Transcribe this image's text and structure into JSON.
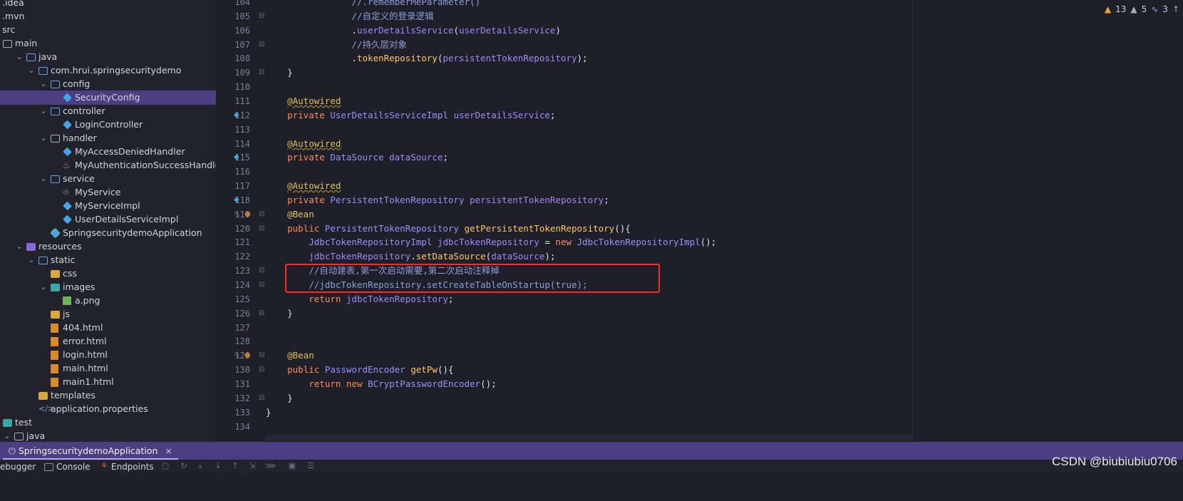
{
  "tree": {
    "items": [
      {
        "label": ".idea",
        "icon": "folder-icon",
        "chev": ""
      },
      {
        "label": ".mvn",
        "icon": "folder-icon",
        "chev": ""
      },
      {
        "label": "src",
        "icon": "folder-icon",
        "chev": ""
      },
      {
        "label": "main",
        "icon": "folder-icon",
        "chev": ""
      },
      {
        "label": "java",
        "icon": "source-folder-icon",
        "chev": "v"
      },
      {
        "label": "com.hrui.springsecuritydemo",
        "icon": "package-icon",
        "chev": "v"
      },
      {
        "label": "config",
        "icon": "package-icon",
        "chev": "v"
      },
      {
        "label": "SecurityConfig",
        "icon": "class-icon",
        "chev": "",
        "selected": true
      },
      {
        "label": "controller",
        "icon": "package-icon",
        "chev": "v"
      },
      {
        "label": "LoginController",
        "icon": "class-icon",
        "chev": ""
      },
      {
        "label": "handler",
        "icon": "folder-icon",
        "chev": "v"
      },
      {
        "label": "MyAccessDeniedHandler",
        "icon": "class-icon",
        "chev": ""
      },
      {
        "label": "MyAuthenticationSuccessHandler.jav",
        "icon": "java-file-icon",
        "chev": ""
      },
      {
        "label": "service",
        "icon": "package-icon",
        "chev": "v"
      },
      {
        "label": "MyService",
        "icon": "interface-icon",
        "chev": ""
      },
      {
        "label": "MyServiceImpl",
        "icon": "class-icon",
        "chev": ""
      },
      {
        "label": "UserDetailsServiceImpl",
        "icon": "class-icon",
        "chev": ""
      },
      {
        "label": "SpringsecuritydemoApplication",
        "icon": "spring-app-icon",
        "chev": ""
      },
      {
        "label": "resources",
        "icon": "resources-folder-icon",
        "chev": "v"
      },
      {
        "label": "static",
        "icon": "package-icon",
        "chev": "v"
      },
      {
        "label": "css",
        "icon": "folder-icon",
        "chev": ""
      },
      {
        "label": "images",
        "icon": "folder-icon",
        "chev": "v"
      },
      {
        "label": "a.png",
        "icon": "image-file-icon",
        "chev": ""
      },
      {
        "label": "js",
        "icon": "folder-icon",
        "chev": ""
      },
      {
        "label": "404.html",
        "icon": "html-file-icon",
        "chev": ""
      },
      {
        "label": "error.html",
        "icon": "html-file-icon",
        "chev": ""
      },
      {
        "label": "login.html",
        "icon": "html-file-icon",
        "chev": ""
      },
      {
        "label": "main.html",
        "icon": "html-file-icon",
        "chev": ""
      },
      {
        "label": "main1.html",
        "icon": "html-file-icon",
        "chev": ""
      },
      {
        "label": "templates",
        "icon": "folder-icon",
        "chev": ""
      },
      {
        "label": "application.properties",
        "icon": "properties-file-icon",
        "chev": ""
      },
      {
        "label": "test",
        "icon": "folder-icon",
        "chev": ""
      },
      {
        "label": "java",
        "icon": "folder-icon",
        "chev": "v"
      }
    ]
  },
  "editor": {
    "lines": [
      {
        "n": "104",
        "text": "                //.rememberMeParameter()"
      },
      {
        "n": "105",
        "text": "                //自定义的登录逻辑"
      },
      {
        "n": "106",
        "text": "                .userDetailsService(userDetailsService)"
      },
      {
        "n": "107",
        "text": "                //持久层对象"
      },
      {
        "n": "108",
        "text": "                .tokenRepository(persistentTokenRepository);"
      },
      {
        "n": "109",
        "text": "    }"
      },
      {
        "n": "110",
        "text": ""
      },
      {
        "n": "111",
        "text": "    @Autowired"
      },
      {
        "n": "112",
        "text": "    private UserDetailsServiceImpl userDetailsService;"
      },
      {
        "n": "113",
        "text": ""
      },
      {
        "n": "114",
        "text": "    @Autowired"
      },
      {
        "n": "115",
        "text": "    private DataSource dataSource;"
      },
      {
        "n": "116",
        "text": ""
      },
      {
        "n": "117",
        "text": "    @Autowired"
      },
      {
        "n": "118",
        "text": "    private PersistentTokenRepository persistentTokenRepository;"
      },
      {
        "n": "119",
        "text": "    @Bean"
      },
      {
        "n": "120",
        "text": "    public PersistentTokenRepository getPersistentTokenRepository(){"
      },
      {
        "n": "121",
        "text": "        JdbcTokenRepositoryImpl jdbcTokenRepository = new JdbcTokenRepositoryImpl();"
      },
      {
        "n": "122",
        "text": "        jdbcTokenRepository.setDataSource(dataSource);"
      },
      {
        "n": "123",
        "text": "        //自动建表,第一次启动需要,第二次启动注释掉"
      },
      {
        "n": "124",
        "text": "        //jdbcTokenRepository.setCreateTableOnStartup(true);"
      },
      {
        "n": "125",
        "text": "        return jdbcTokenRepository;"
      },
      {
        "n": "126",
        "text": "    }"
      },
      {
        "n": "127",
        "text": ""
      },
      {
        "n": "128",
        "text": ""
      },
      {
        "n": "129",
        "text": "    @Bean"
      },
      {
        "n": "130",
        "text": "    public PasswordEncoder getPw(){"
      },
      {
        "n": "131",
        "text": "        return new BCryptPasswordEncoder();"
      },
      {
        "n": "132",
        "text": "    }"
      },
      {
        "n": "133",
        "text": "}"
      },
      {
        "n": "134",
        "text": ""
      }
    ]
  },
  "inspections": {
    "warnings": "13",
    "weak_warnings": "5",
    "typos": "3"
  },
  "bottom": {
    "run_tab": "SpringsecuritydemoApplication",
    "close": "×",
    "debugger": "ebugger",
    "console": "Console",
    "endpoints": "Endpoints"
  },
  "watermark": "CSDN @biubiubiu0706",
  "colors": {
    "accent": "#4b3f82",
    "highlight_box": "#ff2a2a"
  }
}
